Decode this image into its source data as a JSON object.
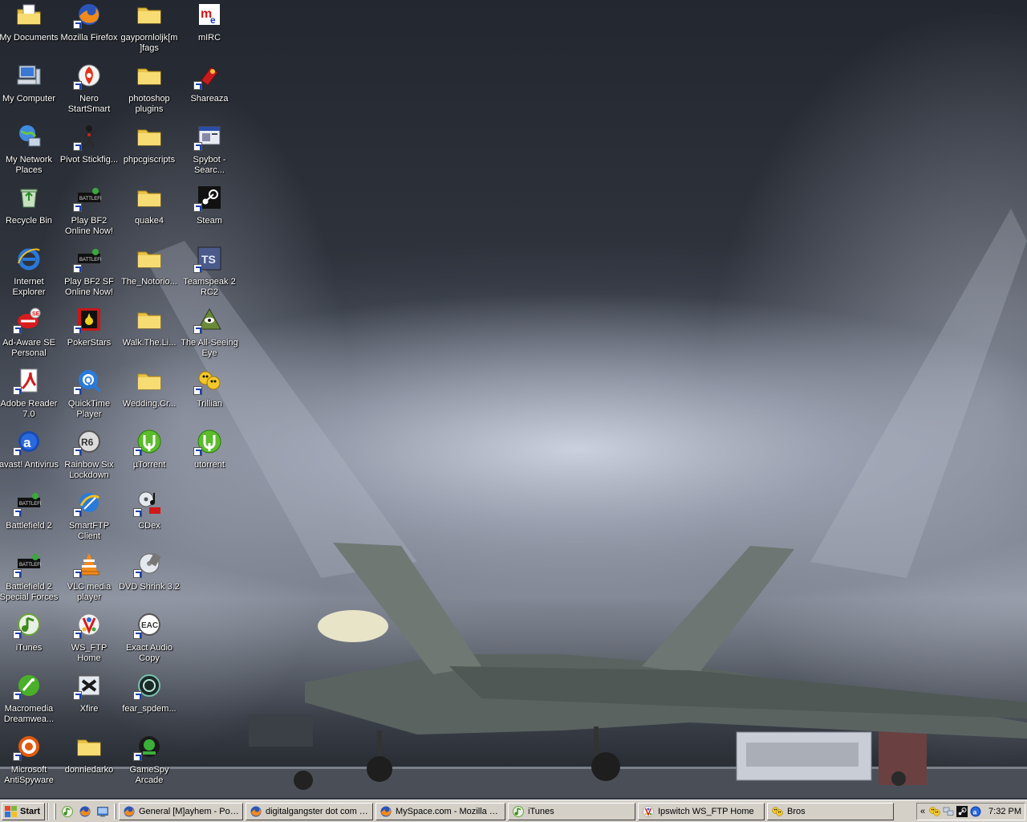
{
  "desktop": {
    "icons": [
      {
        "label": "My Documents",
        "icon": "my-documents-icon"
      },
      {
        "label": "Mozilla Firefox",
        "icon": "firefox-icon"
      },
      {
        "label": "gaypornloljk[m ]fags",
        "icon": "folder-icon"
      },
      {
        "label": "mIRC",
        "icon": "mirc-icon"
      },
      {
        "label": "My Computer",
        "icon": "my-computer-icon"
      },
      {
        "label": "Nero StartSmart",
        "icon": "nero-icon"
      },
      {
        "label": "photoshop plugins",
        "icon": "folder-icon"
      },
      {
        "label": "Shareaza",
        "icon": "shareaza-icon"
      },
      {
        "label": "My Network Places",
        "icon": "network-places-icon"
      },
      {
        "label": "Pivot Stickfig...",
        "icon": "pivot-icon"
      },
      {
        "label": "phpcgiscripts",
        "icon": "folder-icon"
      },
      {
        "label": "Spybot - Searc...",
        "icon": "spybot-icon"
      },
      {
        "label": "Recycle Bin",
        "icon": "recycle-bin-icon"
      },
      {
        "label": "Play BF2 Online Now!",
        "icon": "battlefield-icon"
      },
      {
        "label": "quake4",
        "icon": "folder-icon"
      },
      {
        "label": "Steam",
        "icon": "steam-icon"
      },
      {
        "label": "Internet Explorer",
        "icon": "internet-explorer-icon"
      },
      {
        "label": "Play BF2 SF Online Now!",
        "icon": "battlefield-icon"
      },
      {
        "label": "The_Notorio...",
        "icon": "folder-icon"
      },
      {
        "label": "Teamspeak 2 RC2",
        "icon": "teamspeak-icon"
      },
      {
        "label": "Ad-Aware SE Personal",
        "icon": "ad-aware-icon"
      },
      {
        "label": "PokerStars",
        "icon": "pokerstars-icon"
      },
      {
        "label": "Walk.The.Li...",
        "icon": "folder-icon"
      },
      {
        "label": "The All-Seeing Eye",
        "icon": "all-seeing-eye-icon"
      },
      {
        "label": "Adobe Reader 7.0",
        "icon": "adobe-reader-icon"
      },
      {
        "label": "QuickTime Player",
        "icon": "quicktime-icon"
      },
      {
        "label": "Wedding.Cr...",
        "icon": "folder-icon"
      },
      {
        "label": "Trillian",
        "icon": "trillian-icon"
      },
      {
        "label": "avast! Antivirus",
        "icon": "avast-icon"
      },
      {
        "label": "Rainbow Six Lockdown",
        "icon": "rainbow-six-icon"
      },
      {
        "label": "µTorrent",
        "icon": "utorrent-icon"
      },
      {
        "label": "utorrent",
        "icon": "utorrent-icon"
      },
      {
        "label": "Battlefield 2",
        "icon": "battlefield-icon"
      },
      {
        "label": "SmartFTP Client",
        "icon": "smartftp-icon"
      },
      {
        "label": "CDex",
        "icon": "cdex-icon"
      },
      {
        "label": "Battlefield 2 Special Forces",
        "icon": "battlefield-icon"
      },
      {
        "label": "VLC media player",
        "icon": "vlc-icon"
      },
      {
        "label": "DVD Shrink 3.2",
        "icon": "dvd-shrink-icon"
      },
      {
        "label": "iTunes",
        "icon": "itunes-icon"
      },
      {
        "label": "WS_FTP Home",
        "icon": "ws-ftp-icon"
      },
      {
        "label": "Exact Audio Copy",
        "icon": "exact-audio-copy-icon"
      },
      {
        "label": "Macromedia Dreamwea...",
        "icon": "dreamweaver-icon"
      },
      {
        "label": "Xfire",
        "icon": "xfire-icon"
      },
      {
        "label": "fear_spdem...",
        "icon": "fear-icon"
      },
      {
        "label": "Microsoft AntiSpyware",
        "icon": "antispyware-icon"
      },
      {
        "label": "donniedarko",
        "icon": "folder-icon"
      },
      {
        "label": "GameSpy Arcade",
        "icon": "gamespy-icon"
      }
    ]
  },
  "taskbar": {
    "start_label": "Start",
    "quick_launch": [
      "itunes-icon",
      "firefox-icon",
      "show-desktop-icon"
    ],
    "buttons": [
      {
        "label": "General [M]ayhem - Post...",
        "icon": "firefox-icon"
      },
      {
        "label": "digitalgangster dot com -...",
        "icon": "firefox-icon"
      },
      {
        "label": "MySpace.com - Mozilla Fi...",
        "icon": "firefox-icon"
      },
      {
        "label": "iTunes",
        "icon": "itunes-icon"
      },
      {
        "label": "Ipswitch WS_FTP Home",
        "icon": "ws-ftp-icon"
      },
      {
        "label": "Bros",
        "icon": "trillian-icon"
      }
    ],
    "tray_chevron": "«",
    "tray_icons": [
      "trillian-icon",
      "network-icon",
      "steam-icon",
      "avast-icon"
    ],
    "clock": "7:32 PM"
  },
  "colors": {
    "taskbar_face": "#d4d0c8",
    "folder_yellow": "#f3d35a",
    "label_text": "#ffffff"
  }
}
